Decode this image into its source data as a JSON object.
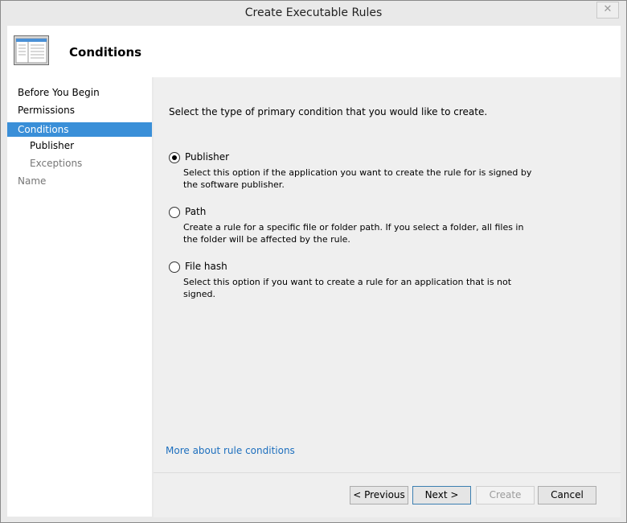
{
  "window": {
    "title": "Create Executable Rules",
    "close_label": "✕"
  },
  "header": {
    "title": "Conditions",
    "icon": "window-icon"
  },
  "sidebar": {
    "items": [
      {
        "label": "Before You Begin",
        "state": "normal"
      },
      {
        "label": "Permissions",
        "state": "normal"
      },
      {
        "label": "Conditions",
        "state": "active"
      },
      {
        "label": "Publisher",
        "state": "normal"
      },
      {
        "label": "Exceptions",
        "state": "disabled"
      },
      {
        "label": "Name",
        "state": "disabled"
      }
    ]
  },
  "main": {
    "instruction": "Select the type of primary condition that you would like to create.",
    "options": [
      {
        "label": "Publisher",
        "selected": true,
        "description": "Select this option if the application you want to create the rule for is signed by the software publisher."
      },
      {
        "label": "Path",
        "selected": false,
        "description": "Create a rule for a specific file or folder path. If you select a folder, all files in the folder will be affected by the rule."
      },
      {
        "label": "File hash",
        "selected": false,
        "description": "Select this option if you want to create a rule for an application that is not signed."
      }
    ],
    "more_link": "More about rule conditions"
  },
  "footer": {
    "previous": "< Previous",
    "next": "Next >",
    "create": "Create",
    "cancel": "Cancel"
  }
}
